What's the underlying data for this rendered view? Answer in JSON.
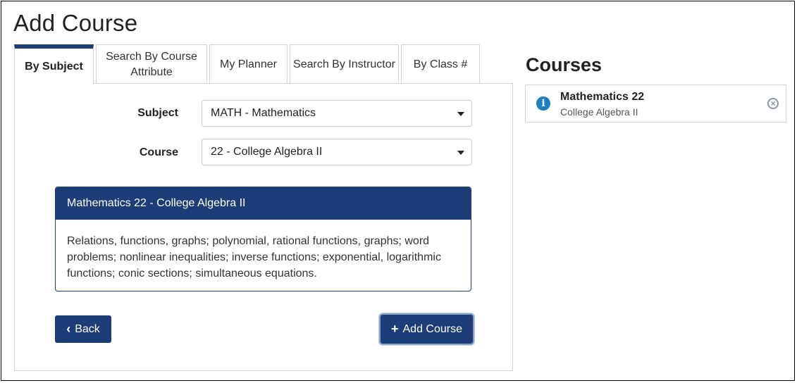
{
  "page": {
    "title": "Add Course"
  },
  "tabs": [
    {
      "label": "By Subject",
      "active": true
    },
    {
      "label": "Search By Course Attribute",
      "active": false
    },
    {
      "label": "My Planner",
      "active": false
    },
    {
      "label": "Search By Instructor",
      "active": false
    },
    {
      "label": "By Class #",
      "active": false
    }
  ],
  "form": {
    "subject_label": "Subject",
    "subject_value": "MATH - Mathematics",
    "course_label": "Course",
    "course_value": "22 - College Algebra II"
  },
  "course_card": {
    "title": "Mathematics 22 - College Algebra II",
    "description": "Relations, functions, graphs; polynomial, rational functions, graphs; word problems; nonlinear inequalities; inverse functions; exponential, logarithmic functions; conic sections; simultaneous equations."
  },
  "buttons": {
    "back_label": "Back",
    "add_label": "Add Course"
  },
  "courses_panel": {
    "title": "Courses",
    "items": [
      {
        "name": "Mathematics 22",
        "description": "College Algebra II"
      }
    ]
  },
  "colors": {
    "primary": "#1c3d78",
    "info": "#1e7fbf",
    "border": "#d4d4d4"
  }
}
